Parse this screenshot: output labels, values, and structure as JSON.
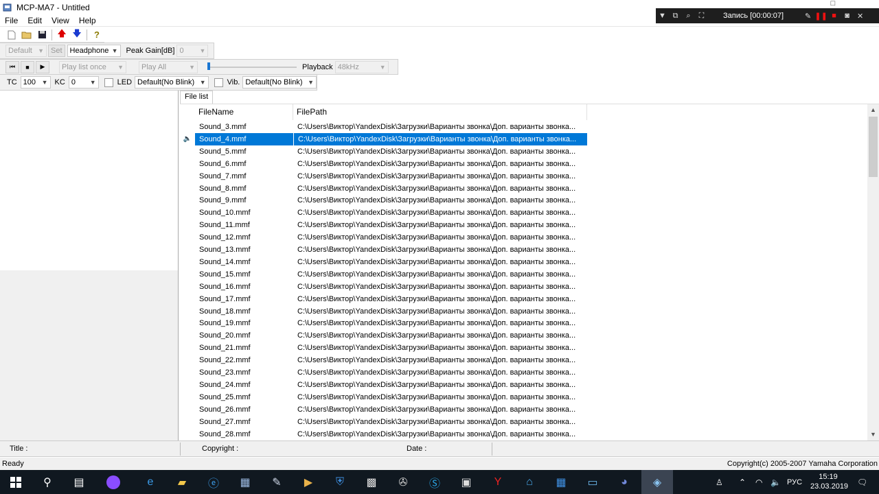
{
  "window": {
    "title": "MCP-MA7 - Untitled"
  },
  "recorder": {
    "label": "Запись [00:00:07]"
  },
  "menu": [
    "File",
    "Edit",
    "View",
    "Help"
  ],
  "toolbar2": {
    "preset": "Default",
    "set_label": "Set",
    "output": "Headphone",
    "peak_label": "Peak Gain[dB]",
    "peak_value": "0"
  },
  "toolbar3": {
    "play_mode": "Play list once",
    "play_scope": "Play All",
    "playback_label": "Playback",
    "playback_rate": "48kHz",
    "volume_level": 0.0
  },
  "toolbar4": {
    "tc_label": "TC",
    "tc_value": "100",
    "kc_label": "KC",
    "kc_value": "0",
    "led_label": "LED",
    "led_value": "Default(No Blink)",
    "vib_label": "Vib.",
    "vib_value": "Default(No Blink)"
  },
  "filelist": {
    "tab_label": "File list",
    "col_filename": "FileName",
    "col_filepath": "FilePath",
    "selected_index": 1,
    "rows": [
      {
        "name": "Sound_3.mmf",
        "path": "C:\\Users\\Виктор\\YandexDisk\\Загрузки\\Варианты звонка\\Доп. варианты звонка..."
      },
      {
        "name": "Sound_4.mmf",
        "path": "C:\\Users\\Виктор\\YandexDisk\\Загрузки\\Варианты звонка\\Доп. варианты звонка..."
      },
      {
        "name": "Sound_5.mmf",
        "path": "C:\\Users\\Виктор\\YandexDisk\\Загрузки\\Варианты звонка\\Доп. варианты звонка..."
      },
      {
        "name": "Sound_6.mmf",
        "path": "C:\\Users\\Виктор\\YandexDisk\\Загрузки\\Варианты звонка\\Доп. варианты звонка..."
      },
      {
        "name": "Sound_7.mmf",
        "path": "C:\\Users\\Виктор\\YandexDisk\\Загрузки\\Варианты звонка\\Доп. варианты звонка..."
      },
      {
        "name": "Sound_8.mmf",
        "path": "C:\\Users\\Виктор\\YandexDisk\\Загрузки\\Варианты звонка\\Доп. варианты звонка..."
      },
      {
        "name": "Sound_9.mmf",
        "path": "C:\\Users\\Виктор\\YandexDisk\\Загрузки\\Варианты звонка\\Доп. варианты звонка..."
      },
      {
        "name": "Sound_10.mmf",
        "path": "C:\\Users\\Виктор\\YandexDisk\\Загрузки\\Варианты звонка\\Доп. варианты звонка..."
      },
      {
        "name": "Sound_11.mmf",
        "path": "C:\\Users\\Виктор\\YandexDisk\\Загрузки\\Варианты звонка\\Доп. варианты звонка..."
      },
      {
        "name": "Sound_12.mmf",
        "path": "C:\\Users\\Виктор\\YandexDisk\\Загрузки\\Варианты звонка\\Доп. варианты звонка..."
      },
      {
        "name": "Sound_13.mmf",
        "path": "C:\\Users\\Виктор\\YandexDisk\\Загрузки\\Варианты звонка\\Доп. варианты звонка..."
      },
      {
        "name": "Sound_14.mmf",
        "path": "C:\\Users\\Виктор\\YandexDisk\\Загрузки\\Варианты звонка\\Доп. варианты звонка..."
      },
      {
        "name": "Sound_15.mmf",
        "path": "C:\\Users\\Виктор\\YandexDisk\\Загрузки\\Варианты звонка\\Доп. варианты звонка..."
      },
      {
        "name": "Sound_16.mmf",
        "path": "C:\\Users\\Виктор\\YandexDisk\\Загрузки\\Варианты звонка\\Доп. варианты звонка..."
      },
      {
        "name": "Sound_17.mmf",
        "path": "C:\\Users\\Виктор\\YandexDisk\\Загрузки\\Варианты звонка\\Доп. варианты звонка..."
      },
      {
        "name": "Sound_18.mmf",
        "path": "C:\\Users\\Виктор\\YandexDisk\\Загрузки\\Варианты звонка\\Доп. варианты звонка..."
      },
      {
        "name": "Sound_19.mmf",
        "path": "C:\\Users\\Виктор\\YandexDisk\\Загрузки\\Варианты звонка\\Доп. варианты звонка..."
      },
      {
        "name": "Sound_20.mmf",
        "path": "C:\\Users\\Виктор\\YandexDisk\\Загрузки\\Варианты звонка\\Доп. варианты звонка..."
      },
      {
        "name": "Sound_21.mmf",
        "path": "C:\\Users\\Виктор\\YandexDisk\\Загрузки\\Варианты звонка\\Доп. варианты звонка..."
      },
      {
        "name": "Sound_22.mmf",
        "path": "C:\\Users\\Виктор\\YandexDisk\\Загрузки\\Варианты звонка\\Доп. варианты звонка..."
      },
      {
        "name": "Sound_23.mmf",
        "path": "C:\\Users\\Виктор\\YandexDisk\\Загрузки\\Варианты звонка\\Доп. варианты звонка..."
      },
      {
        "name": "Sound_24.mmf",
        "path": "C:\\Users\\Виктор\\YandexDisk\\Загрузки\\Варианты звонка\\Доп. варианты звонка..."
      },
      {
        "name": "Sound_25.mmf",
        "path": "C:\\Users\\Виктор\\YandexDisk\\Загрузки\\Варианты звонка\\Доп. варианты звонка..."
      },
      {
        "name": "Sound_26.mmf",
        "path": "C:\\Users\\Виктор\\YandexDisk\\Загрузки\\Варианты звонка\\Доп. варианты звонка..."
      },
      {
        "name": "Sound_27.mmf",
        "path": "C:\\Users\\Виктор\\YandexDisk\\Загрузки\\Варианты звонка\\Доп. варианты звонка..."
      },
      {
        "name": "Sound_28.mmf",
        "path": "C:\\Users\\Виктор\\YandexDisk\\Загрузки\\Варианты звонка\\Доп. варианты звонка..."
      }
    ]
  },
  "info": {
    "title_label": "Title :",
    "copyright_label": "Copyright :",
    "date_label": "Date :"
  },
  "status": {
    "ready": "Ready",
    "copyright": "Copyright(c) 2005-2007 Yamaha Corporation"
  },
  "taskbar": {
    "language": "РУС",
    "time": "15:19",
    "date": "23.03.2019",
    "apps": [
      "start-icon",
      "search-icon",
      "task-view-icon",
      "alice-icon",
      "edge-icon",
      "file-explorer-icon",
      "internet-explorer-icon",
      "notepad-icon",
      "paint-icon",
      "media-player-icon",
      "shield-icon",
      "calculator-icon",
      "mixer-icon",
      "skype-icon",
      "store-icon",
      "yandex-icon",
      "network-app-icon",
      "windows-app-icon",
      "presentation-icon",
      "discord-icon",
      "mcp-ma7-icon"
    ]
  },
  "colors": {
    "selection": "#0078d7",
    "taskbar": "#101820",
    "toolbar": "#f0f0f0"
  }
}
